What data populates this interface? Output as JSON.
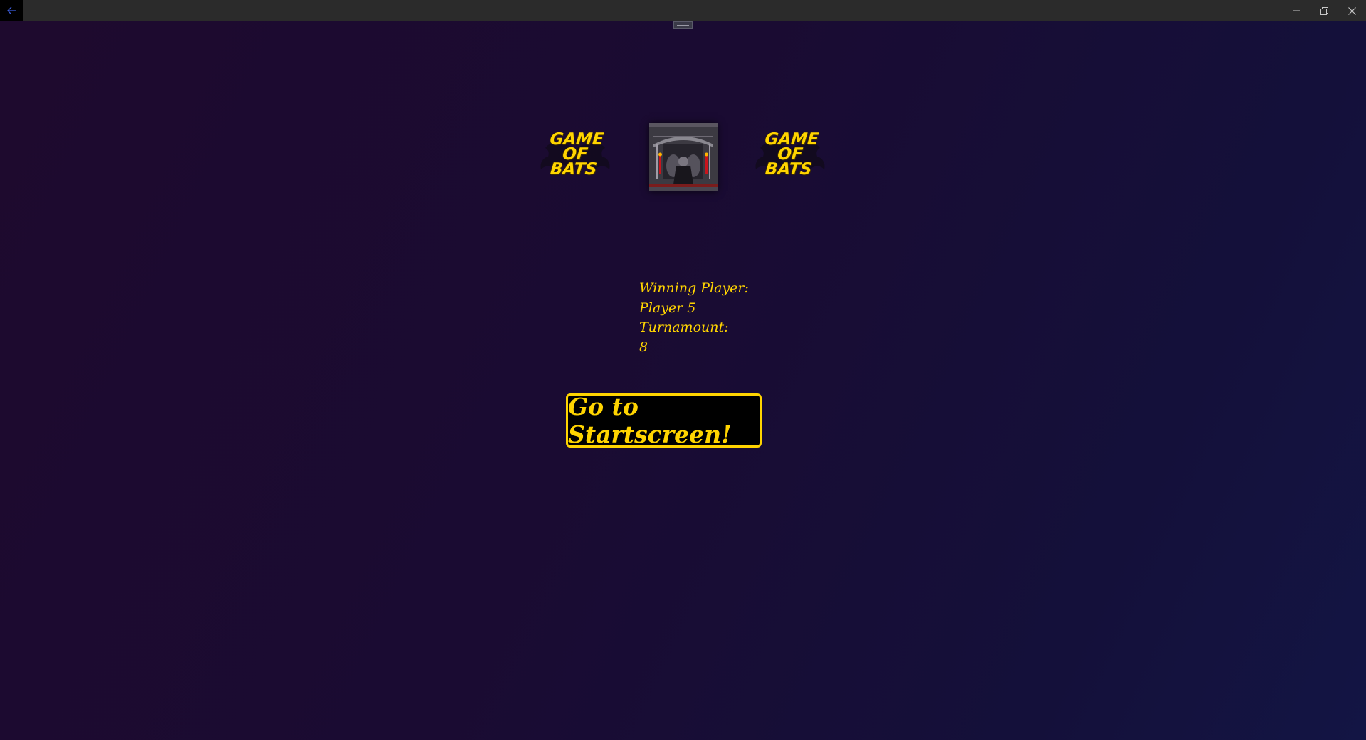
{
  "window": {
    "back_icon": "back-arrow-icon",
    "controls": [
      "minimize-icon",
      "restore-icon",
      "close-icon"
    ]
  },
  "logos": [
    {
      "line1": "GAME",
      "line2": "OF",
      "line3": "BATS"
    },
    {
      "line1": "GAME",
      "line2": "OF",
      "line3": "BATS"
    }
  ],
  "castle_image": {
    "icon": "castle-throne-image"
  },
  "result": {
    "winning_label": "Winning Player:",
    "winning_value": "Player 5",
    "turn_label": "Turnamount:",
    "turn_value": "8"
  },
  "actions": {
    "start_button": "Go to Startscreen!"
  },
  "colors": {
    "accent": "#ffd400",
    "background_start": "#1e0a2e",
    "background_end": "#131544",
    "titlebar": "#2b2b2b"
  }
}
